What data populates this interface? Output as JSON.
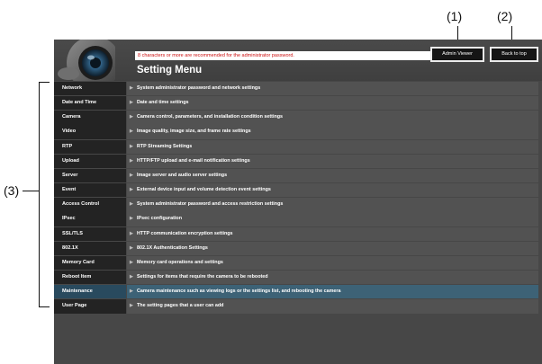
{
  "callouts": {
    "c1": "(1)",
    "c2": "(2)",
    "c3": "(3)"
  },
  "header": {
    "warning": "8 characters or more are recommended for the administrator password.",
    "title": "Setting Menu",
    "admin_viewer_label": "Admin Viewer",
    "back_to_top_label": "Back to top"
  },
  "menu": [
    {
      "label": "Network",
      "desc": "System administrator password and network settings"
    },
    {
      "label": "Date and Time",
      "desc": "Date and time settings"
    },
    {
      "label": "Camera",
      "desc": "Camera control, parameters, and installation condition settings"
    },
    {
      "label": "Video",
      "desc": "Image quality, image size, and frame rate settings"
    },
    {
      "label": "RTP",
      "desc": "RTP Streaming Settings"
    },
    {
      "label": "Upload",
      "desc": "HTTP/FTP upload and e-mail notification settings"
    },
    {
      "label": "Server",
      "desc": "Image server and audio server settings"
    },
    {
      "label": "Event",
      "desc": "External device input and volume detection event settings"
    },
    {
      "label": "Access Control",
      "desc": "System administrator password and access restriction settings"
    },
    {
      "label": "IPsec",
      "desc": "IPsec configuration"
    },
    {
      "label": "SSL/TLS",
      "desc": "HTTP communication encryption settings"
    },
    {
      "label": "802.1X",
      "desc": "802.1X Authentication Settings"
    },
    {
      "label": "Memory Card",
      "desc": "Memory card operations and settings"
    },
    {
      "label": "Reboot Item",
      "desc": "Settings for items that require the camera to be rebooted"
    },
    {
      "label": "Maintenance",
      "desc": "Camera maintenance such as viewing logs or the settings list, and rebooting the camera"
    },
    {
      "label": "User Page",
      "desc": "The setting pages that a user can add"
    }
  ],
  "active_item": "Maintenance",
  "colors": {
    "active": "#3d6276",
    "warning_text": "#cc1111"
  }
}
